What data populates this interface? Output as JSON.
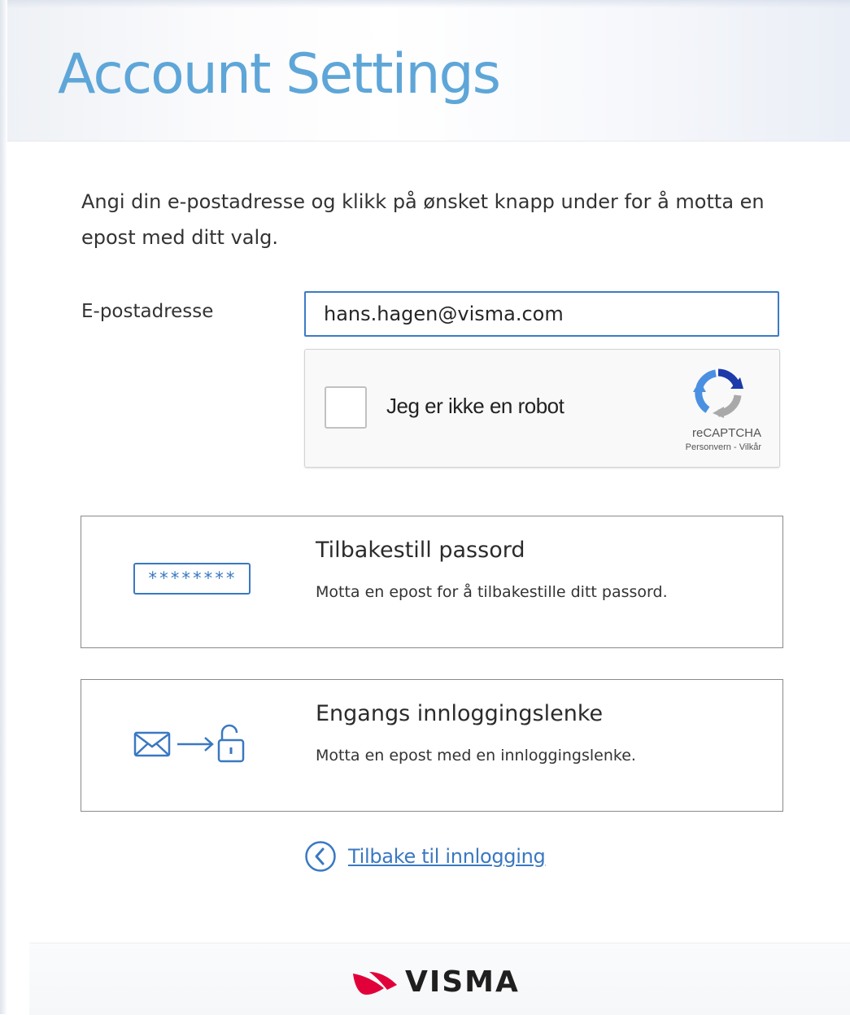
{
  "header": {
    "title": "Account Settings"
  },
  "intro": {
    "text": "Angi din e-postadresse og klikk på ønsket knapp under for å motta en epost med ditt valg."
  },
  "email": {
    "label": "E-postadresse",
    "value": "hans.hagen@visma.com"
  },
  "captcha": {
    "label": "Jeg er ikke en robot",
    "brand": "reCAPTCHA",
    "privacy_link": "Personvern",
    "separator": " - ",
    "terms_link": "Vilkår",
    "checked": false
  },
  "options": [
    {
      "title": "Tilbakestill passord",
      "description": "Motta en epost for å tilbakestille ditt passord.",
      "icon": "password-field-icon",
      "icon_text": "********"
    },
    {
      "title": "Engangs innloggingslenke",
      "description": "Motta en epost med en innloggingslenke.",
      "icon": "email-to-unlock-icon"
    }
  ],
  "back": {
    "label": "Tilbake til innlogging",
    "icon": "chevron-left-circle-icon"
  },
  "footer": {
    "logo_text": "VISMA"
  },
  "colors": {
    "title_blue": "#5ea6d8",
    "accent_blue": "#3a78c2",
    "visma_red": "#e2003a"
  }
}
